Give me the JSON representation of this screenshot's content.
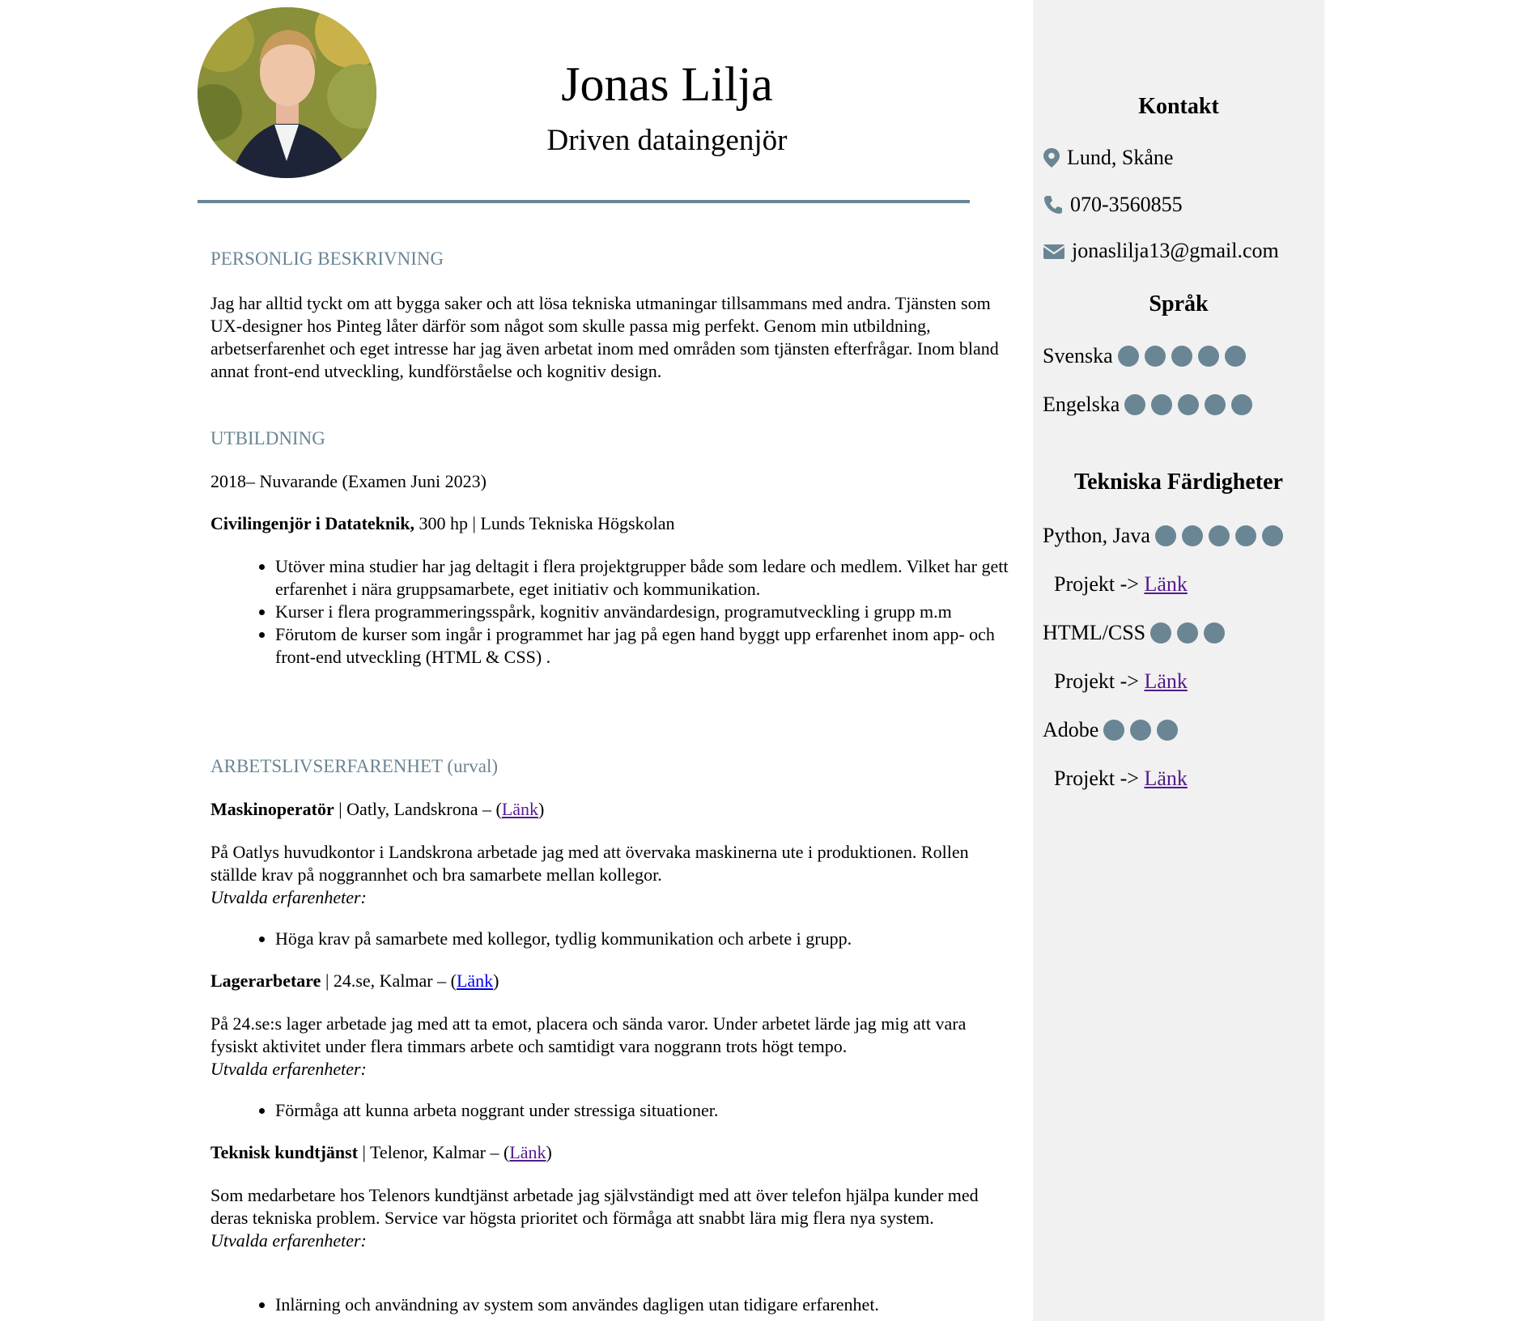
{
  "header": {
    "name": "Jonas Lilja",
    "tagline": "Driven dataingenjör"
  },
  "sections": {
    "personal": {
      "title": "PERSONLIG BESKRIVNING",
      "text": "Jag har alltid tyckt om att bygga saker och att lösa tekniska utmaningar tillsammans med andra. Tjänsten som UX-designer hos Pinteg låter därför som något som skulle passa mig perfekt. Genom min utbildning, arbetserfarenhet och eget intresse har jag även arbetat inom med områden som tjänsten efterfrågar. Inom bland annat front-end utveckling, kundförståelse och kognitiv design."
    },
    "education": {
      "title": "UTBILDNING",
      "period": "2018– Nuvarande (Examen Juni 2023)",
      "degree": "Civilingenjör i Datateknik,",
      "degree_rest": " 300 hp | Lunds Tekniska Högskolan",
      "bullets": [
        "Utöver mina studier har jag deltagit i flera projektgrupper både som ledare och medlem. Vilket har gett erfarenhet i nära gruppsamarbete, eget initiativ och kommunikation.",
        "Kurser i flera programmeringsspårk, kognitiv användardesign, programutveckling i grupp m.m",
        "Förutom de kurser som ingår i programmet har jag på egen hand byggt upp erfarenhet inom app- och front-end utveckling (HTML & CSS) ."
      ]
    },
    "work": {
      "title": "ARBETSLIVSERFARENHET (urval)",
      "experience_label": "Utvalda erfarenheter:",
      "jobs": [
        {
          "role": "Maskinoperatör",
          "place": " | Oatly, Landskrona – (",
          "link": "Länk",
          "close": ")",
          "desc": "På Oatlys huvudkontor i Landskrona arbetade jag med att övervaka maskinerna ute i produktionen. Rollen ställde krav på noggrannhet och bra samarbete mellan kollegor.",
          "bullet": "Höga krav på samarbete med kollegor, tydlig kommunikation och arbete i grupp."
        },
        {
          "role": "Lagerarbetare",
          "place": " | 24.se, Kalmar – (",
          "link": "Länk",
          "close": ")",
          "desc": "På 24.se:s lager arbetade jag med att ta emot, placera och sända varor. Under arbetet lärde jag mig att vara fysiskt aktivitet under flera timmars arbete och samtidigt vara noggrann trots högt tempo.",
          "bullet": "Förmåga att kunna arbeta noggrant under stressiga situationer."
        },
        {
          "role": "Teknisk kundtjänst",
          "place": " | Telenor, Kalmar – (",
          "link": "Länk",
          "close": ")",
          "desc": "Som medarbetare hos Telenors kundtjänst arbetade jag självständigt med att över telefon hjälpa kunder med deras tekniska problem. Service var högsta prioritet och förmåga att snabbt lära mig flera nya system.",
          "bullet": "Inlärning och användning av system som användes dagligen utan tidigare erfarenhet."
        }
      ]
    }
  },
  "sidebar": {
    "contact_title": "Kontakt",
    "location": "Lund, Skåne",
    "location_icon": "map-pin-icon",
    "phone": "070-3560855",
    "phone_icon": "phone-icon",
    "email": "jonaslilja13@gmail.com",
    "email_icon": "envelope-icon",
    "languages_title": "Språk",
    "languages": [
      {
        "name": "Svenska",
        "level": 5
      },
      {
        "name": "Engelska",
        "level": 5
      }
    ],
    "skills_title": "Tekniska Färdigheter",
    "skills": [
      {
        "name": "Python, Java",
        "level": 5,
        "project_label": "Projekt ->",
        "link": "Länk"
      },
      {
        "name": "HTML/CSS",
        "level": 3,
        "project_label": "Projekt ->",
        "link": "Länk"
      },
      {
        "name": "Adobe",
        "level": 3,
        "project_label": "Projekt ->",
        "link": "Länk"
      }
    ],
    "dot_color": "#6a8594"
  },
  "accent_color": "#6a8594"
}
